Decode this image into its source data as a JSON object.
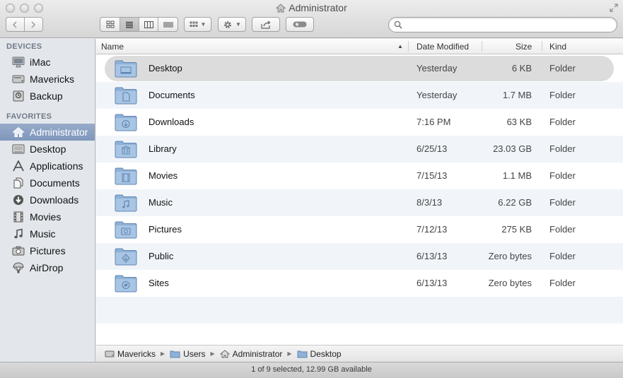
{
  "window": {
    "title": "Administrator"
  },
  "toolbar": {
    "back_icon": "chevron-left-icon",
    "forward_icon": "chevron-right-icon",
    "view_modes": [
      "icon-view-icon",
      "list-view-icon",
      "column-view-icon",
      "coverflow-view-icon"
    ],
    "active_view": "list",
    "arrange_icon": "arrange-grid-icon",
    "action_icon": "gear-icon",
    "share_icon": "share-icon",
    "tag_icon": "tag-toggle-icon",
    "search": {
      "value": "",
      "placeholder": ""
    }
  },
  "sidebar": {
    "devices_heading": "DEVICES",
    "devices": [
      {
        "label": "iMac",
        "icon": "imac-icon"
      },
      {
        "label": "Mavericks",
        "icon": "hard-drive-icon"
      },
      {
        "label": "Backup",
        "icon": "backup-drive-icon"
      }
    ],
    "favorites_heading": "FAVORITES",
    "favorites": [
      {
        "label": "Administrator",
        "icon": "home-icon",
        "selected": true
      },
      {
        "label": "Desktop",
        "icon": "desktop-icon"
      },
      {
        "label": "Applications",
        "icon": "applications-icon"
      },
      {
        "label": "Documents",
        "icon": "documents-icon"
      },
      {
        "label": "Downloads",
        "icon": "downloads-icon"
      },
      {
        "label": "Movies",
        "icon": "movies-icon"
      },
      {
        "label": "Music",
        "icon": "music-icon"
      },
      {
        "label": "Pictures",
        "icon": "pictures-icon"
      },
      {
        "label": "AirDrop",
        "icon": "airdrop-icon"
      }
    ]
  },
  "columns": {
    "name": "Name",
    "date_modified": "Date Modified",
    "size": "Size",
    "kind": "Kind"
  },
  "files": [
    {
      "name": "Desktop",
      "date": "Yesterday",
      "size": "6 KB",
      "kind": "Folder",
      "icon": "desktop-folder-icon",
      "selected": true
    },
    {
      "name": "Documents",
      "date": "Yesterday",
      "size": "1.7 MB",
      "kind": "Folder",
      "icon": "documents-folder-icon"
    },
    {
      "name": "Downloads",
      "date": "7:16 PM",
      "size": "63 KB",
      "kind": "Folder",
      "icon": "downloads-folder-icon"
    },
    {
      "name": "Library",
      "date": "6/25/13",
      "size": "23.03 GB",
      "kind": "Folder",
      "icon": "library-folder-icon"
    },
    {
      "name": "Movies",
      "date": "7/15/13",
      "size": "1.1 MB",
      "kind": "Folder",
      "icon": "movies-folder-icon"
    },
    {
      "name": "Music",
      "date": "8/3/13",
      "size": "6.22 GB",
      "kind": "Folder",
      "icon": "music-folder-icon"
    },
    {
      "name": "Pictures",
      "date": "7/12/13",
      "size": "275 KB",
      "kind": "Folder",
      "icon": "pictures-folder-icon"
    },
    {
      "name": "Public",
      "date": "6/13/13",
      "size": "Zero bytes",
      "kind": "Folder",
      "icon": "public-folder-icon"
    },
    {
      "name": "Sites",
      "date": "6/13/13",
      "size": "Zero bytes",
      "kind": "Folder",
      "icon": "sites-folder-icon"
    }
  ],
  "path": [
    {
      "label": "Mavericks",
      "icon": "hard-drive-icon"
    },
    {
      "label": "Users",
      "icon": "folder-icon"
    },
    {
      "label": "Administrator",
      "icon": "home-icon"
    },
    {
      "label": "Desktop",
      "icon": "folder-icon"
    }
  ],
  "status": "1 of 9 selected, 12.99 GB available",
  "colors": {
    "sidebar_bg": "#e3e7ec",
    "sidebar_selected": "#8aa0c3",
    "row_alt": "#f1f5fa",
    "row_selected": "#dcdcdc",
    "folder": "#8fb1d6"
  }
}
